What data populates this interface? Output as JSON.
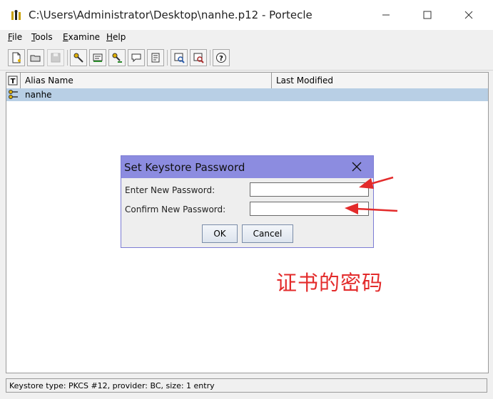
{
  "window": {
    "title": "C:\\Users\\Administrator\\Desktop\\nanhe.p12 - Portecle",
    "controls": [
      "minimize-icon",
      "maximize-icon",
      "close-icon"
    ]
  },
  "menu": [
    {
      "label": "File"
    },
    {
      "label": "Tools"
    },
    {
      "label": "Examine"
    },
    {
      "label": "Help"
    }
  ],
  "toolbar": {
    "buttons": [
      "new-keystore-icon",
      "open-keystore-icon",
      "save-keystore-icon",
      "generate-keypair-icon",
      "import-trusted-cert-icon",
      "import-keypair-icon",
      "set-password-icon",
      "keystore-report-icon",
      "examine-certificate-icon",
      "examine-crl-icon",
      "help-icon"
    ]
  },
  "table": {
    "columns": [
      "Alias Name",
      "Last Modified"
    ],
    "rows": [
      {
        "icon": "key-pair-icon",
        "alias": "nanhe",
        "last_modified": ""
      }
    ]
  },
  "status": "Keystore type: PKCS #12, provider: BC, size: 1 entry",
  "dialog": {
    "title": "Set Keystore Password",
    "fields": [
      {
        "label": "Enter New Password:",
        "value": ""
      },
      {
        "label": "Confirm New Password:",
        "value": ""
      }
    ],
    "ok_label": "OK",
    "cancel_label": "Cancel"
  },
  "annotation": {
    "text": "证书的密码",
    "color": "#e32b2b"
  }
}
